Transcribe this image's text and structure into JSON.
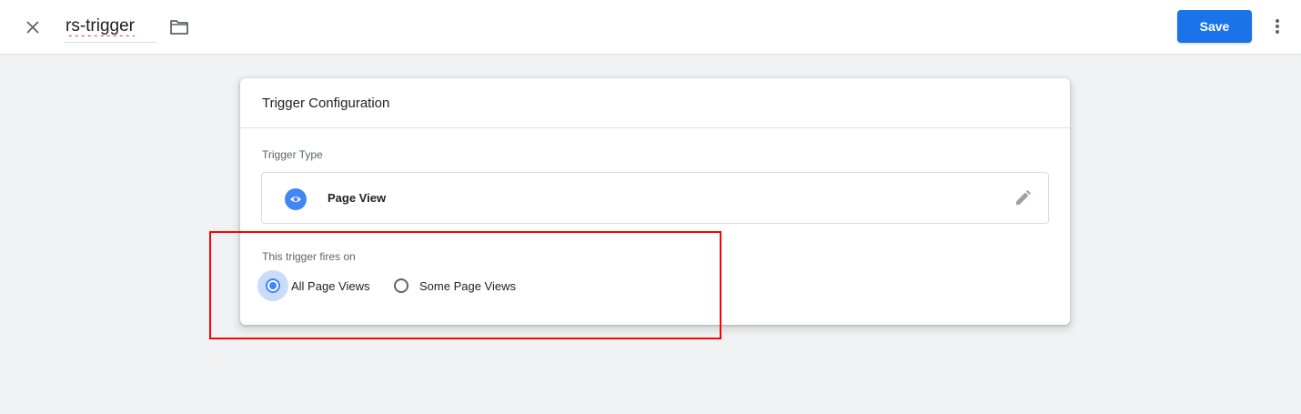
{
  "header": {
    "trigger_name": "rs-trigger",
    "save_label": "Save",
    "icons": {
      "close": "close-icon",
      "folder": "folder-icon",
      "more": "more-vert-icon"
    },
    "save_color": "#1a73e8"
  },
  "card": {
    "title": "Trigger Configuration",
    "trigger_type_label": "Trigger Type",
    "trigger_type": {
      "name": "Page View",
      "icon": "eye-icon",
      "icon_color": "#4285f4",
      "edit_icon": "pencil-icon"
    },
    "fires_on_label": "This trigger fires on",
    "fires_on_options": [
      {
        "label": "All Page Views",
        "selected": true
      },
      {
        "label": "Some Page Views",
        "selected": false
      }
    ]
  },
  "annotation": {
    "highlight_color": "#ff0000"
  }
}
